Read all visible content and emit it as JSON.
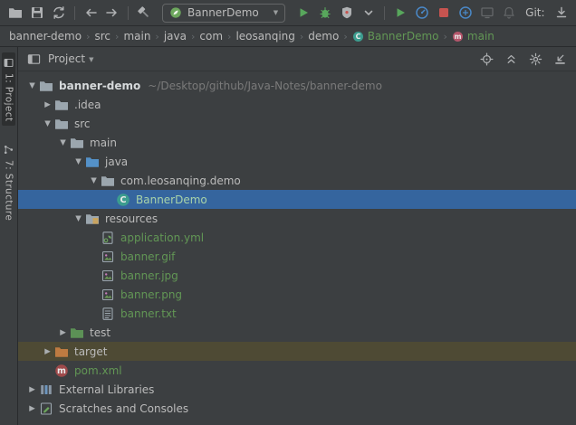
{
  "colors": {
    "selection": "#35659E",
    "target-row": "#4E4A34",
    "green": "#629755"
  },
  "toolbar": {
    "items": [
      {
        "type": "button",
        "name": "open-button",
        "icon": "open"
      },
      {
        "type": "button",
        "name": "save-all-button",
        "icon": "save"
      },
      {
        "type": "button",
        "name": "sync-button",
        "icon": "sync"
      },
      {
        "type": "sep"
      },
      {
        "type": "button",
        "name": "back-button",
        "icon": "back"
      },
      {
        "type": "button",
        "name": "forward-button",
        "icon": "forward"
      },
      {
        "type": "sep"
      },
      {
        "type": "button",
        "name": "build-button",
        "icon": "build"
      },
      {
        "type": "combo",
        "name": "run-config-select",
        "icon": "spring",
        "label": "BannerDemo"
      },
      {
        "type": "button",
        "name": "run-button",
        "icon": "run"
      },
      {
        "type": "button",
        "name": "debug-button",
        "icon": "debug"
      },
      {
        "type": "button",
        "name": "coverage-button",
        "icon": "coverage"
      },
      {
        "type": "button",
        "name": "run-options-chevron",
        "icon": "chevron-down"
      },
      {
        "type": "sep"
      },
      {
        "type": "button",
        "name": "rerun-button",
        "icon": "run"
      },
      {
        "type": "button",
        "name": "profiler-button",
        "icon": "profiler"
      },
      {
        "type": "button",
        "name": "stop-button",
        "icon": "stop"
      },
      {
        "type": "button",
        "name": "services-button",
        "icon": "services"
      },
      {
        "type": "spacer"
      },
      {
        "type": "button",
        "name": "monitor-button",
        "icon": "monitor",
        "dim": true
      },
      {
        "type": "button",
        "name": "notifications-button",
        "icon": "bell",
        "dim": true
      },
      {
        "type": "label",
        "name": "git-label",
        "text": "Git:"
      },
      {
        "type": "button",
        "name": "update-project-button",
        "icon": "download"
      }
    ]
  },
  "breadcrumbs": {
    "separator": "›",
    "items": [
      {
        "label": "banner-demo"
      },
      {
        "label": "src"
      },
      {
        "label": "main"
      },
      {
        "label": "java"
      },
      {
        "label": "com"
      },
      {
        "label": "leosanqing"
      },
      {
        "label": "demo"
      },
      {
        "label": "BannerDemo",
        "icon": "class",
        "green": true
      },
      {
        "label": "main",
        "icon": "method",
        "green": true
      }
    ]
  },
  "stripe": {
    "tabs": [
      {
        "label": "1: Project",
        "icon": "project-tab",
        "active": true
      },
      {
        "label": "7: Structure",
        "icon": "structure-tab",
        "active": false
      }
    ]
  },
  "panel": {
    "title": "Project",
    "actions": [
      {
        "name": "locate-button",
        "icon": "locate"
      },
      {
        "name": "collapse-all-button",
        "icon": "collapse"
      },
      {
        "name": "settings-button",
        "icon": "gear"
      },
      {
        "name": "hide-panel-button",
        "icon": "hide"
      }
    ]
  },
  "tree": {
    "rows": [
      {
        "label": "banner-demo",
        "suffix": "~/Desktop/github/Java-Notes/banner-demo",
        "level": 0,
        "arrow": "open",
        "icon": "folder",
        "bold": true
      },
      {
        "label": ".idea",
        "level": 1,
        "arrow": "closed",
        "icon": "folder"
      },
      {
        "label": "src",
        "level": 1,
        "arrow": "open",
        "icon": "folder"
      },
      {
        "label": "main",
        "level": 2,
        "arrow": "open",
        "icon": "folder"
      },
      {
        "label": "java",
        "level": 3,
        "arrow": "open",
        "icon": "folder-java"
      },
      {
        "label": "com.leosanqing.demo",
        "level": 4,
        "arrow": "open",
        "icon": "package"
      },
      {
        "label": "BannerDemo",
        "level": 5,
        "icon": "class",
        "selected": true
      },
      {
        "label": "resources",
        "level": 3,
        "arrow": "open",
        "icon": "folder-resources"
      },
      {
        "label": "application.yml",
        "level": 4,
        "icon": "yml",
        "green": true
      },
      {
        "label": "banner.gif",
        "level": 4,
        "icon": "image",
        "green": true
      },
      {
        "label": "banner.jpg",
        "level": 4,
        "icon": "image",
        "green": true
      },
      {
        "label": "banner.png",
        "level": 4,
        "icon": "image",
        "green": true
      },
      {
        "label": "banner.txt",
        "level": 4,
        "icon": "txt",
        "green": true
      },
      {
        "label": "test",
        "level": 2,
        "arrow": "closed",
        "icon": "folder-test"
      },
      {
        "label": "target",
        "level": 1,
        "arrow": "closed",
        "icon": "folder-target",
        "highlight": "target"
      },
      {
        "label": "pom.xml",
        "level": 1,
        "icon": "maven",
        "green": true
      },
      {
        "label": "External Libraries",
        "level": 0,
        "arrow": "closed",
        "icon": "libraries"
      },
      {
        "label": "Scratches and Consoles",
        "level": 0,
        "arrow": "closed",
        "icon": "scratches"
      }
    ]
  }
}
